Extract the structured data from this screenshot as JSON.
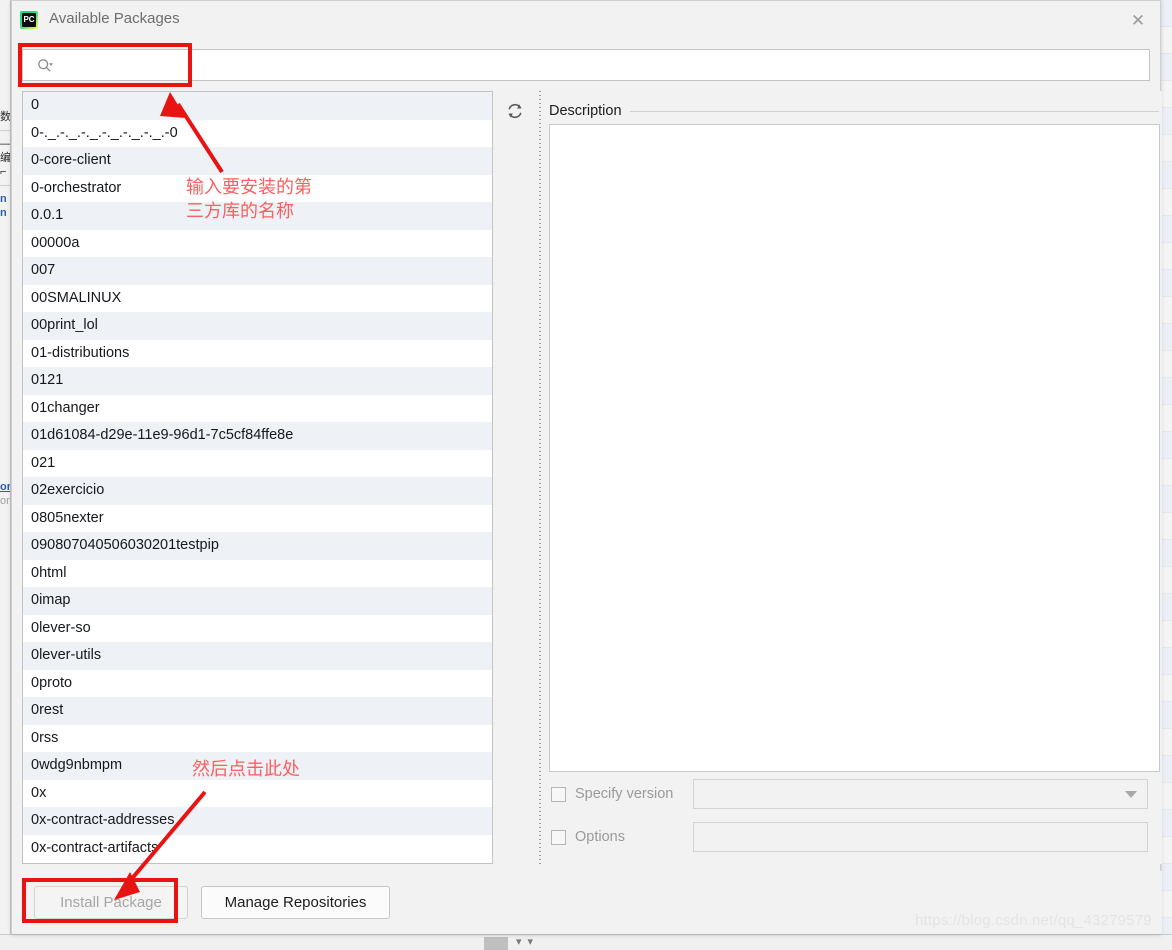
{
  "window": {
    "title": "Available Packages",
    "icon": "pycharm-icon",
    "icon_text": "PC",
    "close_label": "✕"
  },
  "search": {
    "value": "",
    "placeholder": "",
    "icon": "search-icon"
  },
  "package_list": {
    "items": [
      "0",
      "0-._.-._.-._.-._.-._.-._.-0",
      "0-core-client",
      "0-orchestrator",
      "0.0.1",
      "00000a",
      "007",
      "00SMALINUX",
      "00print_lol",
      "01-distributions",
      "0121",
      "01changer",
      "01d61084-d29e-11e9-96d1-7c5cf84ffe8e",
      "021",
      "02exercicio",
      "0805nexter",
      "090807040506030201testpip",
      "0html",
      "0imap",
      "0lever-so",
      "0lever-utils",
      "0proto",
      "0rest",
      "0rss",
      "0wdg9nbmpm",
      "0x",
      "0x-contract-addresses",
      "0x-contract-artifacts"
    ]
  },
  "toolbar": {
    "reload_icon": "reload-icon"
  },
  "description": {
    "header": "Description",
    "body": ""
  },
  "options": {
    "specify_version": {
      "label": "Specify version",
      "checked": false,
      "value": "",
      "arrow_icon": "chevron-down-icon"
    },
    "options_field": {
      "label": "Options",
      "checked": false,
      "value": ""
    }
  },
  "footer": {
    "install_label": "Install Package",
    "install_disabled": true,
    "manage_label": "Manage Repositories"
  },
  "annotations": {
    "text_1": "输入要安装的第\n三方库的名称",
    "text_2": "然后点击此处",
    "box_color": "#e81313",
    "text_color": "#fb5f5f"
  },
  "watermark": {
    "text": "https://blog.csdn.net/qq_43279579"
  },
  "background_window": {
    "left_glyphs": [
      "数",
      "—",
      "编",
      "⌐",
      "n",
      "n",
      "or",
      "on"
    ]
  }
}
